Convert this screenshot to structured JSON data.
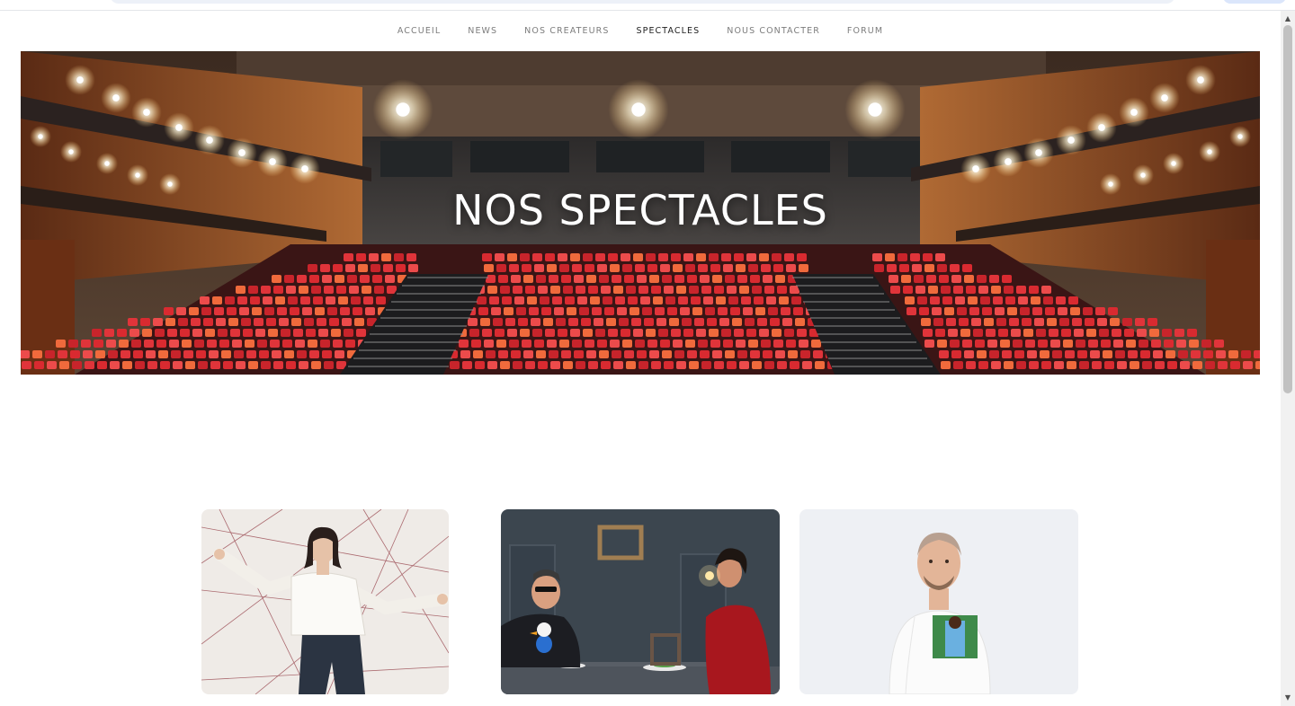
{
  "nav": {
    "items": [
      {
        "label": "ACCUEIL"
      },
      {
        "label": "NEWS"
      },
      {
        "label": "NOS CREATEURS"
      },
      {
        "label": "SPECTACLES"
      },
      {
        "label": "NOUS CONTACTER"
      },
      {
        "label": "FORUM"
      }
    ],
    "active_index": 3
  },
  "hero": {
    "title": "NOS SPECTACLES"
  },
  "cards": [
    {
      "image": "woman-white-shirt-photo"
    },
    {
      "image": "dinner-scene-photo"
    },
    {
      "image": "man-white-tshirt-photo"
    }
  ],
  "colors": {
    "nav_text": "#7d7d7d",
    "nav_active": "#1e1e1e",
    "seat_red": "#e0343a",
    "hero_title": "#ffffff"
  },
  "scrollbar": {
    "up_icon": "triangle-up-icon",
    "down_icon": "triangle-down-icon"
  }
}
